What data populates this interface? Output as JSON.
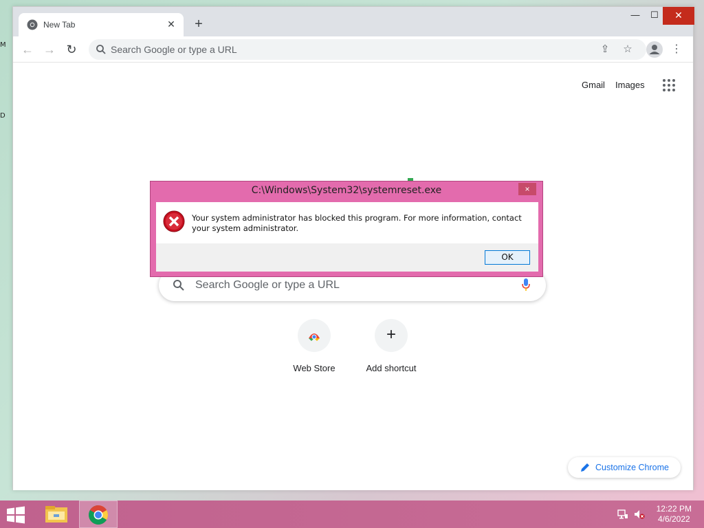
{
  "browser": {
    "tab_title": "New Tab",
    "omnibox_placeholder": "Search Google or type a URL"
  },
  "ntp": {
    "gmail_label": "Gmail",
    "images_label": "Images",
    "search_placeholder": "Search Google or type a URL",
    "shortcuts": [
      {
        "label": "Web Store",
        "icon": "chrome-web-store-icon"
      },
      {
        "label": "Add shortcut",
        "icon": "plus-icon"
      }
    ],
    "customize_label": "Customize Chrome"
  },
  "dialog": {
    "title": "C:\\Windows\\System32\\systemreset.exe",
    "message": "Your system administrator has blocked this program. For more information, contact your system administrator.",
    "ok_label": "OK",
    "close_label": "×"
  },
  "taskbar": {
    "time": "12:22 PM",
    "date": "4/6/2022"
  },
  "colors": {
    "dialog_frame": "#e36bad",
    "taskbar": "#c0628e",
    "accent_blue": "#1a73e8",
    "error_red": "#c50f1f"
  }
}
